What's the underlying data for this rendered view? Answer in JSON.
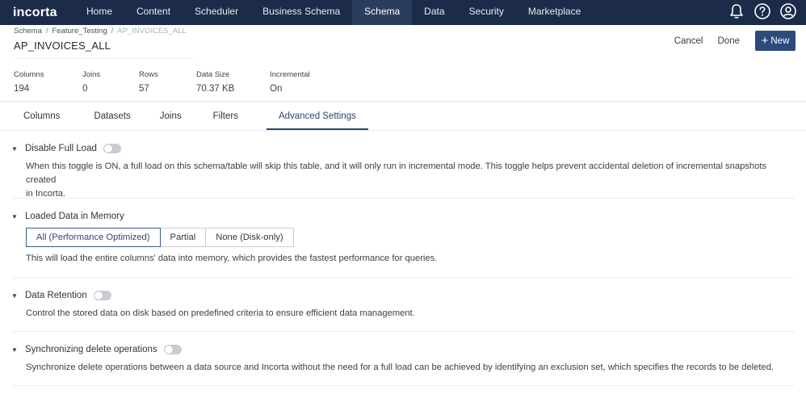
{
  "app": {
    "logo": "incorta",
    "nav": [
      "Home",
      "Content",
      "Scheduler",
      "Business Schema",
      "Schema",
      "Data",
      "Security",
      "Marketplace"
    ],
    "active_nav": "Schema",
    "icons": [
      "bell-icon",
      "help-icon",
      "user-icon"
    ]
  },
  "breadcrumb": {
    "items": [
      "Schema",
      "Feature_Testing"
    ],
    "current": "AP_INVOICES_ALL",
    "separator": "/"
  },
  "title": "AP_INVOICES_ALL",
  "actions": {
    "cancel": "Cancel",
    "done": "Done",
    "new": "New"
  },
  "stats": [
    {
      "label": "Columns",
      "value": "194"
    },
    {
      "label": "Joins",
      "value": "0"
    },
    {
      "label": "Rows",
      "value": "57"
    },
    {
      "label": "Data Size",
      "value": "70.37 KB"
    },
    {
      "label": "Incremental",
      "value": "On"
    }
  ],
  "tabs": [
    "Columns",
    "Datasets",
    "Joins",
    "Filters",
    "Advanced Settings"
  ],
  "active_tab": "Advanced Settings",
  "sections": {
    "disable_full_load": {
      "title": "Disable Full Load",
      "toggle_on": false,
      "desc1": "When this toggle is ON, a full load on this schema/table will skip this table, and it will only run in incremental mode. This toggle helps prevent accidental deletion of incremental snapshots created",
      "desc2": "in Incorta."
    },
    "loaded_in_memory": {
      "title": "Loaded Data in Memory",
      "options": [
        "All (Performance Optimized)",
        "Partial",
        "None (Disk-only)"
      ],
      "selected": "All (Performance Optimized)",
      "desc": "This will load the entire columns' data into memory, which provides the fastest performance for queries."
    },
    "data_retention": {
      "title": "Data Retention",
      "toggle_on": false,
      "desc": "Control the stored data on disk based on predefined criteria to ensure efficient data management."
    },
    "sync_delete": {
      "title": "Synchronizing delete operations",
      "toggle_on": false,
      "desc": "Synchronize delete operations between a data source and Incorta without the need for a full load can be achieved by identifying an exclusion set, which specifies the records to be deleted."
    }
  },
  "colors": {
    "nav_bg": "#1b2b48",
    "accent": "#2c4a7c"
  }
}
